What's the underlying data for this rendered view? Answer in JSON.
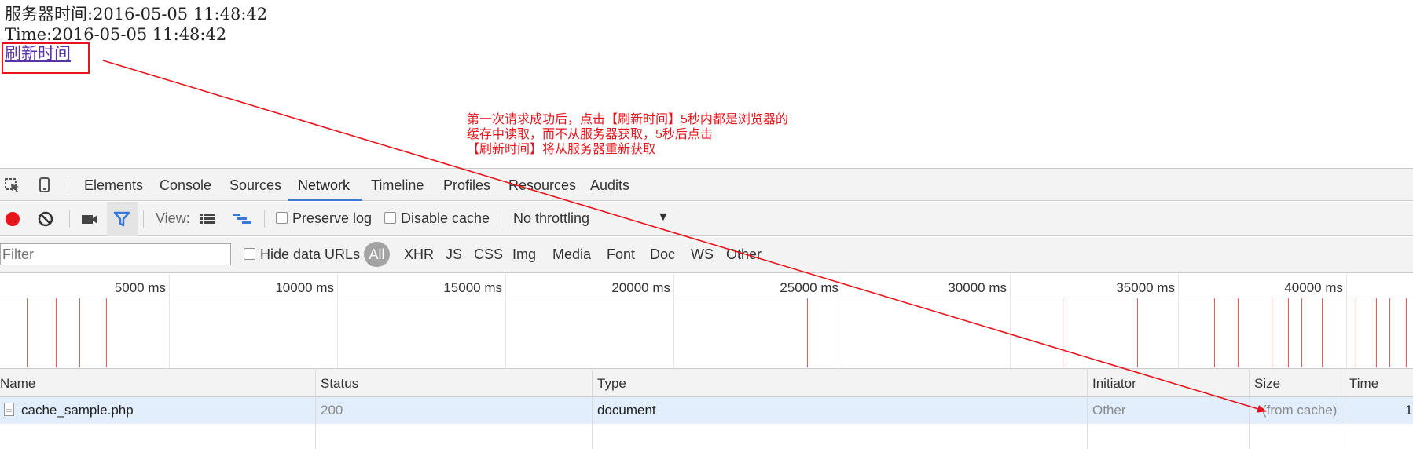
{
  "page": {
    "server_time_line": "服务器时间:2016-05-05 11:48:42",
    "time_line": "Time:2016-05-05 11:48:42",
    "refresh_link": "刷新时间"
  },
  "annotation": {
    "lines": [
      "第一次请求成功后，点击【刷新时间】5秒内都是浏览器的",
      "缓存中读取，而不从服务器获取，5秒后点击",
      "【刷新时间】将从服务器重新获取"
    ],
    "color": "#e8141c"
  },
  "devtools": {
    "tabs": [
      "Elements",
      "Console",
      "Sources",
      "Network",
      "Timeline",
      "Profiles",
      "Resources",
      "Audits"
    ],
    "active_tab": "Network",
    "icons": [
      "inspect-element-icon",
      "device-mode-icon"
    ],
    "controls": {
      "record_icon": "record-icon",
      "clear_icon": "clear-icon",
      "screenshot_icon": "camera-icon",
      "filter_icon": "filter-icon",
      "view_label": "View:",
      "view_icons": [
        "list-view-icon",
        "waterfall-view-icon"
      ],
      "preserve_log": "Preserve log",
      "disable_cache": "Disable cache",
      "throttling": "No throttling"
    },
    "filter": {
      "placeholder": "Filter",
      "hide_data_urls": "Hide data URLs",
      "types": [
        "All",
        "XHR",
        "JS",
        "CSS",
        "Img",
        "Media",
        "Font",
        "Doc",
        "WS",
        "Other"
      ],
      "active_type": "All"
    },
    "overview": {
      "ticks": [
        "5000 ms",
        "10000 ms",
        "15000 ms",
        "20000 ms",
        "25000 ms",
        "30000 ms",
        "35000 ms",
        "40000 ms"
      ],
      "request_marks_ms": [
        800,
        1650,
        2350,
        3150,
        24000,
        31600,
        33800,
        36100,
        36800,
        37800,
        38300,
        38700,
        39300,
        40300,
        40900,
        41300,
        41800,
        42300,
        42600,
        43300
      ]
    },
    "table": {
      "columns": [
        "Name",
        "Status",
        "Type",
        "Initiator",
        "Size",
        "Time"
      ],
      "rows": [
        {
          "name": "cache_sample.php",
          "status": "200",
          "type": "document",
          "initiator": "Other",
          "size": "(from cache)",
          "time": "1"
        }
      ]
    },
    "colors": {
      "accent": "#3879d9",
      "record": "#e8141c",
      "row_selected": "#e2eefc",
      "mark": "#ef5a5f"
    }
  }
}
